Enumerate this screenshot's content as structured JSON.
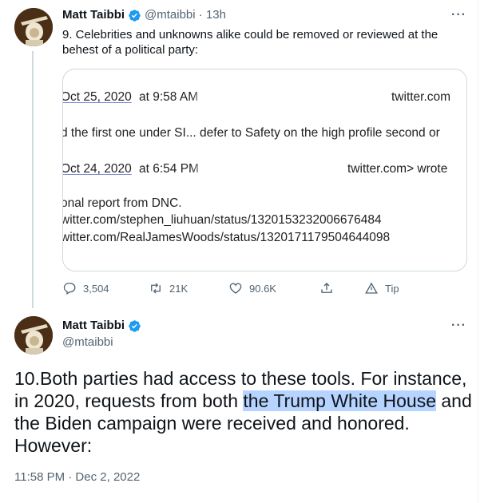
{
  "tweet1": {
    "author_name": "Matt Taibbi",
    "handle": "@mtaibbi",
    "separator": "·",
    "time": "13h",
    "text": "9. Celebrities and unknowns alike could be removed or reviewed at the behest of a political party:",
    "screenshot_lines": [
      "Oct 25, 2020",
      "at 9:58 AM",
      "twitter.com",
      "d the first one under SI... defer to Safety on the high profile second or",
      "Oct 24, 2020",
      "at 6:54 PM",
      "twitter.com> wrote",
      "onal report from DNC.",
      "witter.com/stephen_liuhuan/status/1320153232006676484",
      "witter.com/RealJamesWoods/status/1320171179504644098"
    ],
    "actions": {
      "replies": "3,504",
      "retweets": "21K",
      "likes": "90.6K",
      "tip_label": "Tip"
    }
  },
  "tweet2": {
    "author_name": "Matt Taibbi",
    "handle": "@mtaibbi",
    "text_before": "10.Both parties had access to these tools. For instance, in 2020, requests from both ",
    "text_highlight": "the Trump White House",
    "text_after": " and the Biden campaign were received and honored. However:",
    "timestamp": "11:58 PM · Dec 2, 2022"
  },
  "more_icon": "···",
  "colors": {
    "verified": "#1d9bf0",
    "secondary_text": "#536471",
    "highlight": "#b6d4ff",
    "thread_line": "#cfd9de"
  }
}
